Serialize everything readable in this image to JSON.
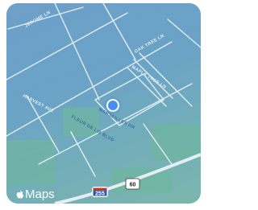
{
  "map": {
    "brand": "Maps",
    "streets": [
      {
        "id": "jerome",
        "label": "JEROME LN"
      },
      {
        "id": "harvest",
        "label": "HARVEST AVE"
      },
      {
        "id": "oak",
        "label": "OAK TREE LN"
      },
      {
        "id": "maple",
        "label": "MAPLE TREE LN"
      },
      {
        "id": "marseilles",
        "label": "MARSEILLES DR"
      },
      {
        "id": "fleur",
        "label": "FLEUR DE LIS BLVD"
      }
    ],
    "shields": [
      {
        "id": "i255",
        "label": "255",
        "type": "interstate"
      },
      {
        "id": "us60",
        "label": "60",
        "type": "us-route"
      }
    ],
    "location_marker": "current-location",
    "colors": {
      "water_bg": "#6aa3c6",
      "park": "#6fb5a6",
      "road": "#e6eff6",
      "marker": "#3b82f6"
    }
  }
}
